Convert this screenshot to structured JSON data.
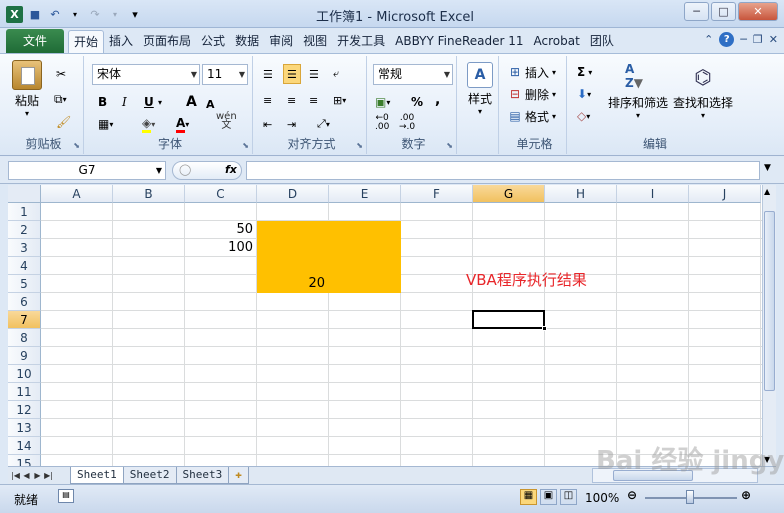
{
  "window": {
    "title": "工作簿1 - Microsoft Excel",
    "minimize": "─",
    "restore": "□",
    "close": "✕"
  },
  "qat": {
    "save": "💾",
    "undo": "↶",
    "redo": "↷",
    "customize": "▾"
  },
  "tabs": {
    "file": "文件",
    "items": [
      "开始",
      "插入",
      "页面布局",
      "公式",
      "数据",
      "审阅",
      "视图",
      "开发工具",
      "ABBYY FineReader 11",
      "Acrobat",
      "团队"
    ],
    "active": "开始"
  },
  "ribbon": {
    "clipboard": {
      "label": "剪贴板",
      "paste": "粘贴"
    },
    "font": {
      "label": "字体",
      "name": "宋体",
      "size": "11",
      "bold": "B",
      "italic": "I",
      "underline": "U",
      "grow": "A",
      "shrink": "A",
      "fontcolor": "A",
      "wen": "wén"
    },
    "align": {
      "label": "对齐方式"
    },
    "number": {
      "label": "数字",
      "format": "常规",
      "percent": "%",
      "comma": ","
    },
    "styles": {
      "label": "样式",
      "styles": "样式"
    },
    "cells": {
      "label": "单元格",
      "insert": "插入",
      "delete": "删除",
      "format": "格式"
    },
    "editing": {
      "label": "编辑",
      "sort": "排序和筛选",
      "find": "查找和选择",
      "sigma": "Σ"
    }
  },
  "formula": {
    "namebox": "G7",
    "fx": "fx",
    "value": ""
  },
  "grid": {
    "columns": [
      "A",
      "B",
      "C",
      "D",
      "E",
      "F",
      "G",
      "H",
      "I",
      "J"
    ],
    "rows": [
      "1",
      "2",
      "3",
      "4",
      "5",
      "6",
      "7",
      "8",
      "9",
      "10",
      "11",
      "12",
      "13",
      "14",
      "15"
    ],
    "selected_col": "G",
    "selected_row": "7",
    "cells": {
      "C2": "50",
      "C3": "100",
      "D5": "20"
    },
    "fill_color": "#ffc000",
    "annotation": "VBA程序执行结果"
  },
  "sheets": [
    "Sheet1",
    "Sheet2",
    "Sheet3"
  ],
  "active_sheet": "Sheet1",
  "status": {
    "ready": "就绪",
    "zoom": "100%"
  },
  "watermark": "Bai 经验 jingyan.baidu.com"
}
